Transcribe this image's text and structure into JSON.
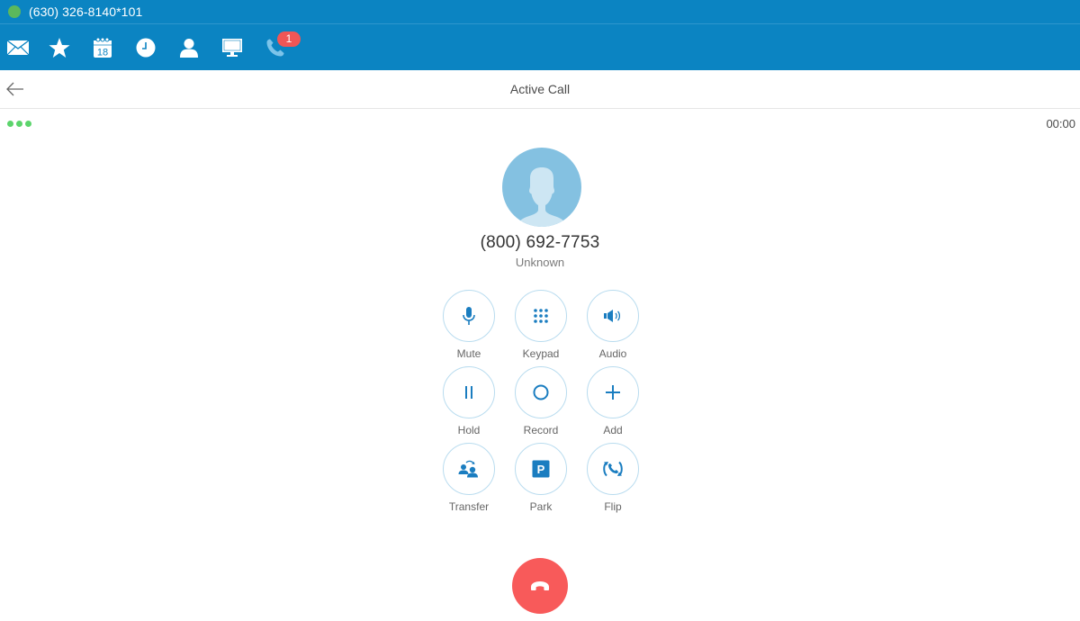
{
  "account": {
    "status": "online",
    "status_color": "#5cb85c",
    "label": "(630) 326-8140*101"
  },
  "nav": {
    "items": [
      {
        "name": "messages",
        "icon": "envelope-icon"
      },
      {
        "name": "favorites",
        "icon": "star-icon"
      },
      {
        "name": "calendar",
        "icon": "calendar-icon",
        "day": "18"
      },
      {
        "name": "history",
        "icon": "clock-icon"
      },
      {
        "name": "contacts",
        "icon": "person-icon"
      },
      {
        "name": "screen",
        "icon": "monitor-icon"
      },
      {
        "name": "calls",
        "icon": "phone-icon",
        "active": true,
        "badge": "1"
      }
    ],
    "accent_color": "#0b84c2",
    "badge_color": "#f05656"
  },
  "header": {
    "back_icon": "arrow-left-icon",
    "title": "Active Call"
  },
  "call": {
    "signal_bars": 3,
    "timer": "00:00",
    "number": "(800) 692-7753",
    "name": "Unknown"
  },
  "controls": [
    {
      "label": "Mute",
      "icon": "microphone-icon"
    },
    {
      "label": "Keypad",
      "icon": "keypad-icon"
    },
    {
      "label": "Audio",
      "icon": "speaker-icon"
    },
    {
      "label": "Hold",
      "icon": "pause-icon"
    },
    {
      "label": "Record",
      "icon": "record-icon"
    },
    {
      "label": "Add",
      "icon": "plus-icon"
    },
    {
      "label": "Transfer",
      "icon": "transfer-icon"
    },
    {
      "label": "Park",
      "icon": "park-icon"
    },
    {
      "label": "Flip",
      "icon": "flip-icon"
    }
  ],
  "hangup": {
    "icon": "hang-up-icon",
    "color": "#f85a5a"
  }
}
